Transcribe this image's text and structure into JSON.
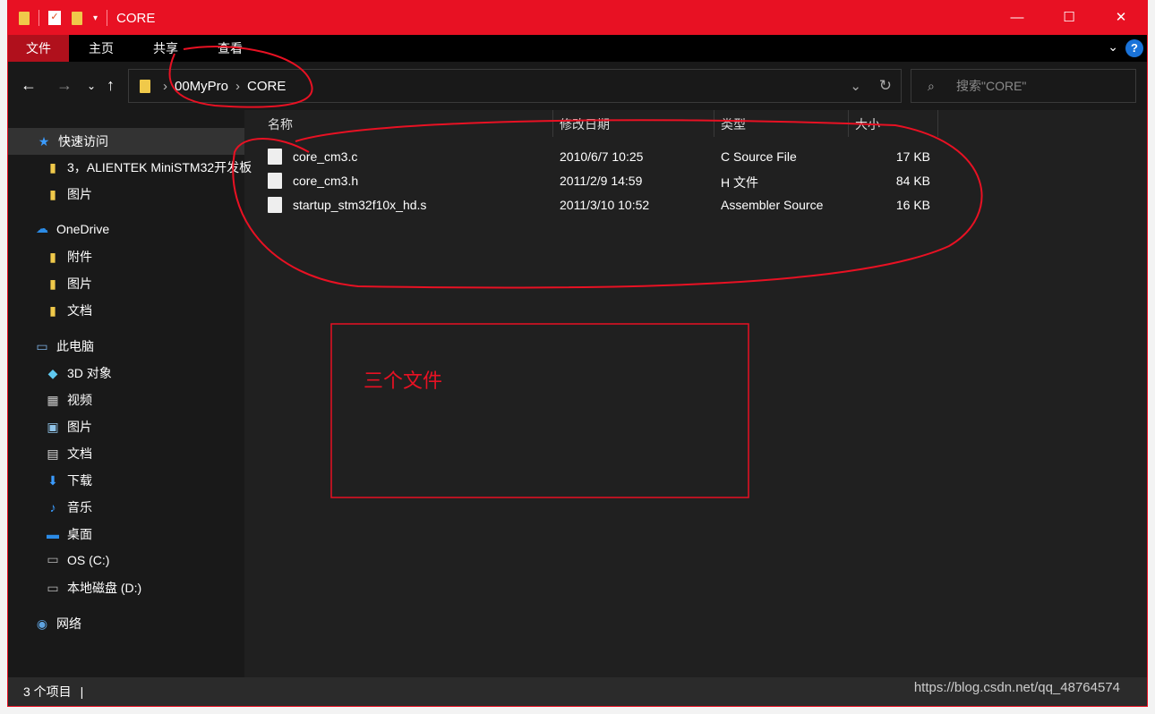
{
  "window": {
    "title": "CORE"
  },
  "title_controls": {
    "minimize": "—",
    "maximize": "☐",
    "close": "✕"
  },
  "ribbon": {
    "tabs": [
      "文件",
      "主页",
      "共享",
      "查看"
    ],
    "help": "?"
  },
  "address": {
    "crumbs": [
      "00MyPro",
      "CORE"
    ],
    "search_placeholder": "搜索\"CORE\""
  },
  "sidebar": {
    "items": [
      {
        "label": "快速访问",
        "icon": "star-icon"
      },
      {
        "label": "3，ALIENTEK MiniSTM32开发板",
        "icon": "folder-icon"
      },
      {
        "label": "图片",
        "icon": "folder-icon"
      },
      {
        "label": "OneDrive",
        "icon": "cloud-icon"
      },
      {
        "label": "附件",
        "icon": "folder-icon"
      },
      {
        "label": "图片",
        "icon": "folder-icon"
      },
      {
        "label": "文档",
        "icon": "folder-icon"
      },
      {
        "label": "此电脑",
        "icon": "computer-icon"
      },
      {
        "label": "3D 对象",
        "icon": "cube-icon"
      },
      {
        "label": "视频",
        "icon": "video-icon"
      },
      {
        "label": "图片",
        "icon": "picture-icon"
      },
      {
        "label": "文档",
        "icon": "document-icon"
      },
      {
        "label": "下载",
        "icon": "download-icon"
      },
      {
        "label": "音乐",
        "icon": "music-icon"
      },
      {
        "label": "桌面",
        "icon": "desktop-icon"
      },
      {
        "label": "OS (C:)",
        "icon": "drive-icon"
      },
      {
        "label": "本地磁盘 (D:)",
        "icon": "drive-icon"
      },
      {
        "label": "网络",
        "icon": "network-icon"
      }
    ]
  },
  "columns": [
    "名称",
    "修改日期",
    "类型",
    "大小"
  ],
  "files": [
    {
      "name": "core_cm3.c",
      "date": "2010/6/7 10:25",
      "type": "C Source File",
      "size": "17 KB"
    },
    {
      "name": "core_cm3.h",
      "date": "2011/2/9 14:59",
      "type": "H 文件",
      "size": "84 KB"
    },
    {
      "name": "startup_stm32f10x_hd.s",
      "date": "2011/3/10 10:52",
      "type": "Assembler Source",
      "size": "16 KB"
    }
  ],
  "status": {
    "count": "3 个项目"
  },
  "annotation": {
    "text": "三个文件",
    "color": "#e81123"
  },
  "watermark": "https://blog.csdn.net/qq_48764574",
  "colors": {
    "titlebar": "#e81123",
    "active_tab": "#b0101c",
    "background": "#202020"
  }
}
